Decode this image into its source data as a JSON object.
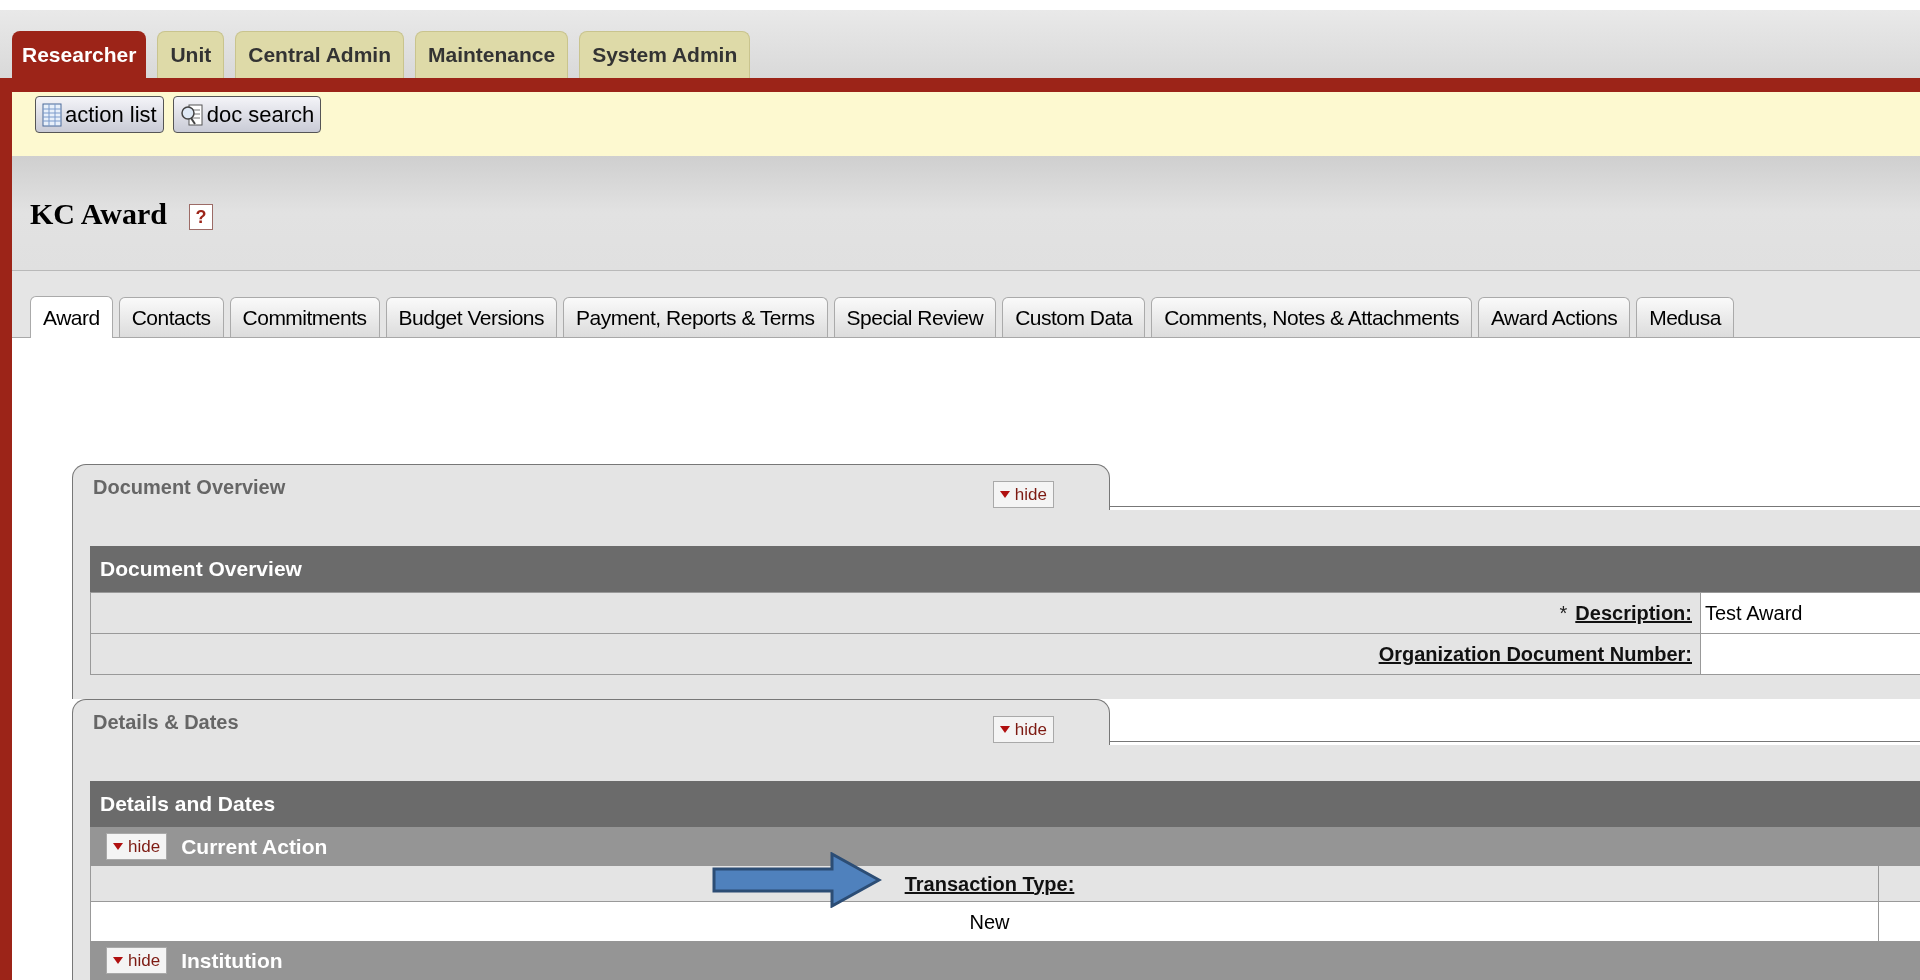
{
  "top_tabs": [
    {
      "label": "Researcher",
      "selected": true
    },
    {
      "label": "Unit",
      "selected": false
    },
    {
      "label": "Central Admin",
      "selected": false
    },
    {
      "label": "Maintenance",
      "selected": false
    },
    {
      "label": "System Admin",
      "selected": false
    }
  ],
  "toolbar": [
    {
      "label": "action list",
      "kind": "list"
    },
    {
      "label": "doc search",
      "kind": "search"
    }
  ],
  "page_title": "KC Award",
  "help": "?",
  "tabs": [
    {
      "label": "Award",
      "selected": true
    },
    {
      "label": "Contacts",
      "selected": false
    },
    {
      "label": "Commitments",
      "selected": false
    },
    {
      "label": "Budget Versions",
      "selected": false
    },
    {
      "label": "Payment, Reports & Terms",
      "selected": false
    },
    {
      "label": "Special Review",
      "selected": false
    },
    {
      "label": "Custom Data",
      "selected": false
    },
    {
      "label": "Comments, Notes & Attachments",
      "selected": false
    },
    {
      "label": "Award Actions",
      "selected": false
    },
    {
      "label": "Medusa",
      "selected": false
    }
  ],
  "sections": [
    {
      "kind": "fields",
      "tab_title": "Document Overview",
      "toggle": "hide",
      "header": "Document Overview",
      "rows": [
        {
          "marker": "*",
          "label": "Description:",
          "value": "Test Award"
        },
        {
          "label": "Organization Document Number:"
        }
      ]
    },
    {
      "kind": "subsections",
      "tab_title": "Details & Dates",
      "toggle": "hide",
      "header": "Details and Dates",
      "subsections": [
        {
          "toggle": "hide",
          "title": "Current Action",
          "column": "Transaction Type:",
          "value": "New"
        },
        {
          "toggle": "hide",
          "title": "Institution"
        }
      ]
    }
  ]
}
